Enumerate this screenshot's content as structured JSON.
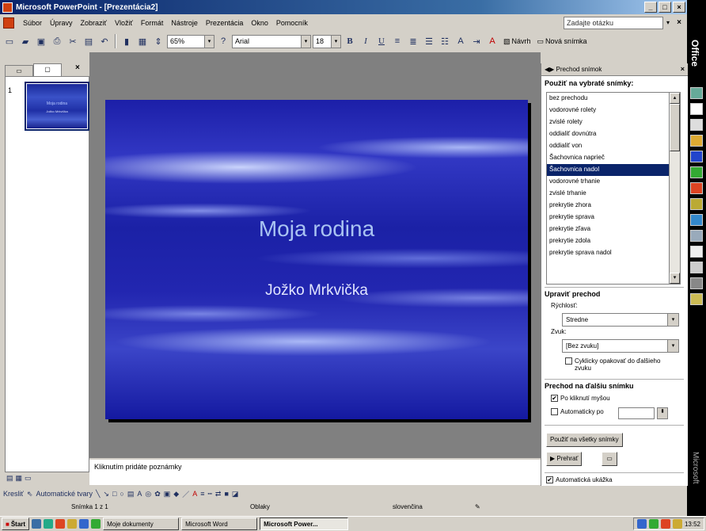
{
  "window": {
    "title": "Microsoft PowerPoint - [Prezentácia2]",
    "btn_min": "_",
    "btn_max": "□",
    "btn_close": "×"
  },
  "menu": {
    "items": [
      "Súbor",
      "Úpravy",
      "Zobraziť",
      "Vložiť",
      "Formát",
      "Nástroje",
      "Prezentácia",
      "Okno",
      "Pomocník"
    ],
    "ask_placeholder": "Zadajte otázku",
    "ask_arrow": "▾",
    "close": "×"
  },
  "toolbar": {
    "zoom": "65%",
    "font": "Arial",
    "font_size": "18",
    "bold": "B",
    "italic": "I",
    "underline": "U",
    "design_label": "Návrh",
    "new_slide_label": "Nová snímka",
    "combo_arrow": "▾"
  },
  "slides_pane": {
    "tab_outline": "Osnova",
    "tab_slides": "Snímky",
    "close": "×",
    "slide_number": "1",
    "thumb_title": "Moja rodina",
    "thumb_subtitle": "Jožko Mrkvička"
  },
  "slide": {
    "title": "Moja rodina",
    "subtitle": "Jožko Mrkvička"
  },
  "notes": {
    "placeholder": "Kliknutím pridáte poznámky"
  },
  "task_pane": {
    "header": "Prechod snímok",
    "close": "×",
    "apply_heading": "Použiť na vybraté snímky:",
    "transitions": [
      "bez prechodu",
      "vodorovné rolety",
      "zvislé rolety",
      "oddialiť dovnútra",
      "oddialiť von",
      "Šachovnica naprieč",
      "Šachovnica nadol",
      "vodorovné trhanie",
      "zvislé trhanie",
      "prekrytie zhora",
      "prekrytie sprava",
      "prekrytie zľava",
      "prekrytie zdola",
      "prekrytie sprava nadol"
    ],
    "selected_index": 6,
    "modify_heading": "Upraviť prechod",
    "speed_label": "Rýchlosť:",
    "speed_value": "Stredne",
    "sound_label": "Zvuk:",
    "sound_value": "[Bez zvuku]",
    "loop_label": "Cyklicky opakovať do ďalšieho zvuku",
    "advance_heading": "Prechod na ďalšiu snímku",
    "on_click_label": "Po kliknutí myšou",
    "auto_label": "Automaticky po",
    "apply_all": "Použiť na všetky snímky",
    "play": "Prehrať",
    "autopreview": "Automatická ukážka",
    "check_mark": "✔",
    "scroll_up": "▴",
    "scroll_down": "▾"
  },
  "drawbar": {
    "draw": "Kresliť",
    "autoshapes": "Automatické tvary"
  },
  "status": {
    "slide": "Snímka 1 z 1",
    "design": "Oblaky",
    "language": "slovenčina"
  },
  "taskbar": {
    "start": "Štart",
    "tasks": [
      "Moje dokumenty",
      "Microsoft Word",
      "Microsoft Power..."
    ],
    "clock": "13:52"
  },
  "office_bar": {
    "top": "Office",
    "bottom": "Microsoft"
  }
}
